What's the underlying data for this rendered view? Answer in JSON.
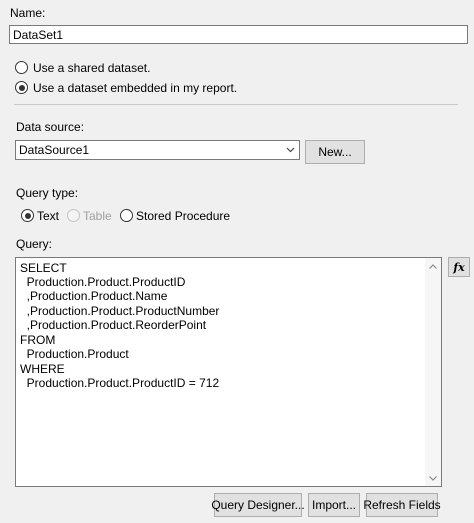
{
  "name": {
    "label": "Name:",
    "value": "DataSet1"
  },
  "dataset_source": {
    "options": [
      {
        "label": "Use a shared dataset.",
        "selected": false
      },
      {
        "label": "Use a dataset embedded in my report.",
        "selected": true
      }
    ]
  },
  "data_source": {
    "label": "Data source:",
    "selected": "DataSource1",
    "new_button": "New..."
  },
  "query_type": {
    "label": "Query type:",
    "options": [
      {
        "label": "Text",
        "selected": true,
        "enabled": true
      },
      {
        "label": "Table",
        "selected": false,
        "enabled": false
      },
      {
        "label": "Stored Procedure",
        "selected": false,
        "enabled": true
      }
    ]
  },
  "query": {
    "label": "Query:",
    "lines": [
      "SELECT",
      "  Production.Product.ProductID",
      "  ,Production.Product.Name",
      "  ,Production.Product.ProductNumber",
      "  ,Production.Product.ReorderPoint",
      "FROM",
      "  Production.Product",
      "WHERE",
      "  Production.Product.ProductID = 712"
    ],
    "expression_button": "fx"
  },
  "buttons": {
    "query_designer": "Query Designer...",
    "import": "Import...",
    "refresh_fields": "Refresh Fields"
  }
}
